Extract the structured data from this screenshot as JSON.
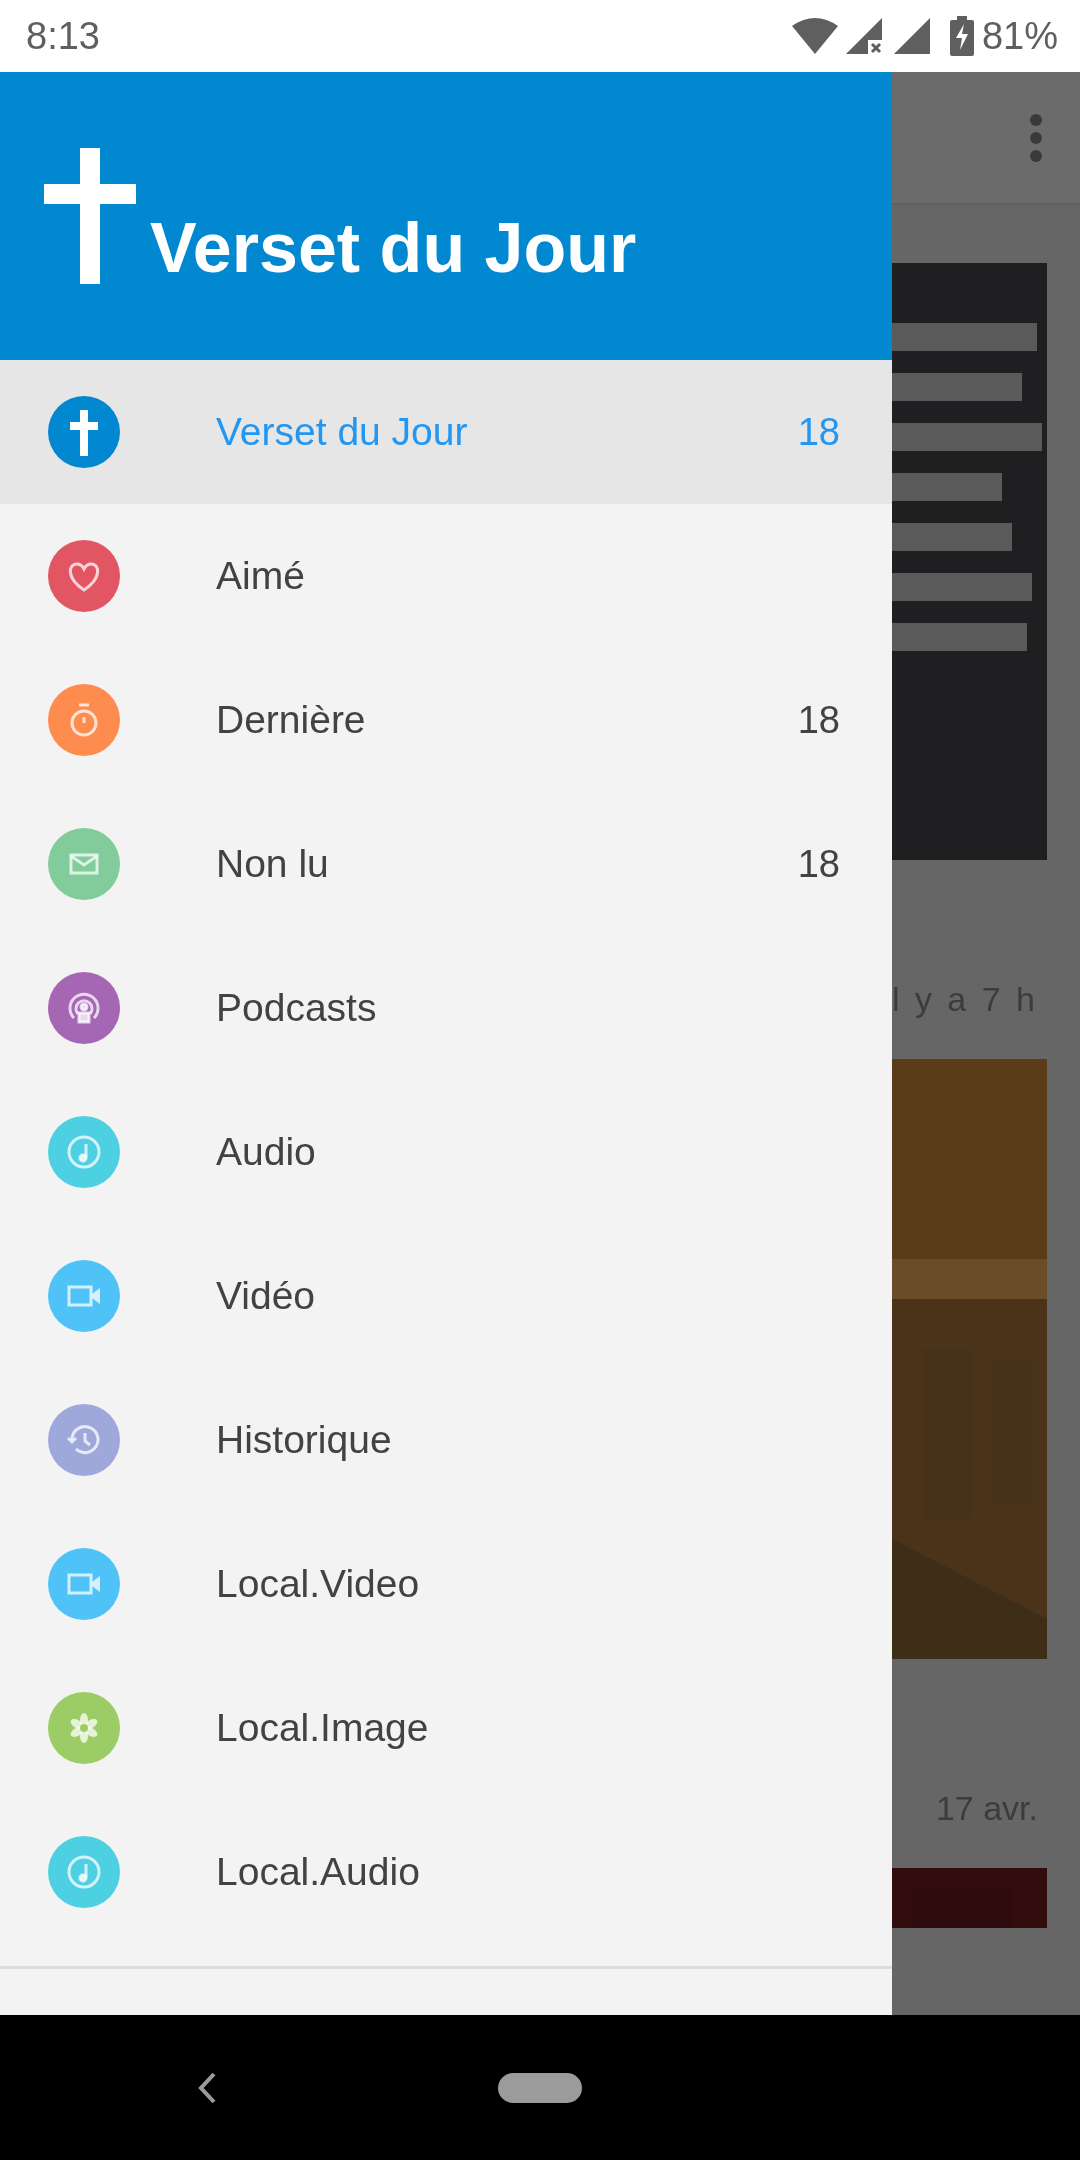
{
  "status_bar": {
    "time": "8:13",
    "battery": "81%"
  },
  "drawer": {
    "title": "Verset du Jour",
    "items": [
      {
        "label": "Verset du Jour",
        "count": "18",
        "selected": true,
        "kind": "cross",
        "color": "#0288d1"
      },
      {
        "label": "Aimé",
        "selected": false,
        "kind": "heart",
        "color": "#e25563"
      },
      {
        "label": "Dernière",
        "count": "18",
        "selected": false,
        "kind": "timer",
        "color": "#fe8c4f"
      },
      {
        "label": "Non lu",
        "count": "18",
        "selected": false,
        "kind": "mail",
        "color": "#81cc9a"
      },
      {
        "label": "Podcasts",
        "selected": false,
        "kind": "podcast",
        "color": "#a566b4"
      },
      {
        "label": "Audio",
        "selected": false,
        "kind": "music",
        "color": "#4dd0e1"
      },
      {
        "label": "Vidéo",
        "selected": false,
        "kind": "video",
        "color": "#4fc3f7"
      },
      {
        "label": "Historique",
        "selected": false,
        "kind": "history",
        "color": "#9fa8da"
      },
      {
        "label": "Local.Video",
        "selected": false,
        "kind": "video",
        "color": "#4fc3f7"
      },
      {
        "label": "Local.Image",
        "selected": false,
        "kind": "flower",
        "color": "#9ccc65"
      },
      {
        "label": "Local.Audio",
        "selected": false,
        "kind": "music",
        "color": "#4dd0e1"
      }
    ]
  },
  "feed": [
    {
      "time": "l y a 7 h"
    },
    {
      "time": "17 avr."
    }
  ]
}
